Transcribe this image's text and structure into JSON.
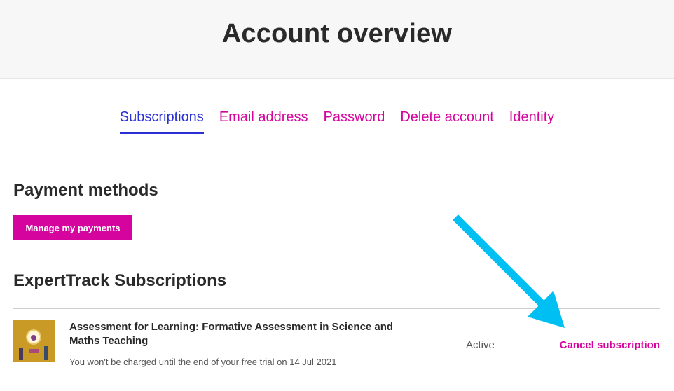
{
  "page": {
    "title": "Account overview"
  },
  "tabs": [
    {
      "label": "Subscriptions",
      "active": true
    },
    {
      "label": "Email address",
      "active": false
    },
    {
      "label": "Password",
      "active": false
    },
    {
      "label": "Delete account",
      "active": false
    },
    {
      "label": "Identity",
      "active": false
    }
  ],
  "payment_methods": {
    "title": "Payment methods",
    "manage_button": "Manage my payments"
  },
  "expert_track": {
    "title": "ExpertTrack Subscriptions",
    "items": [
      {
        "course_title": "Assessment for Learning: Formative Assessment in Science and Maths Teaching",
        "note": "You won't be charged until the end of your free trial on 14 Jul 2021",
        "status": "Active",
        "action": "Cancel subscription"
      }
    ]
  },
  "colors": {
    "accent": "#d5049e",
    "active_tab": "#2a30d6",
    "annotation_arrow": "#00bff3",
    "header_bg": "#f7f7f7"
  },
  "icons": {
    "course_thumbnail": "course-thumbnail-image",
    "annotation": "arrow-annotation-icon"
  }
}
